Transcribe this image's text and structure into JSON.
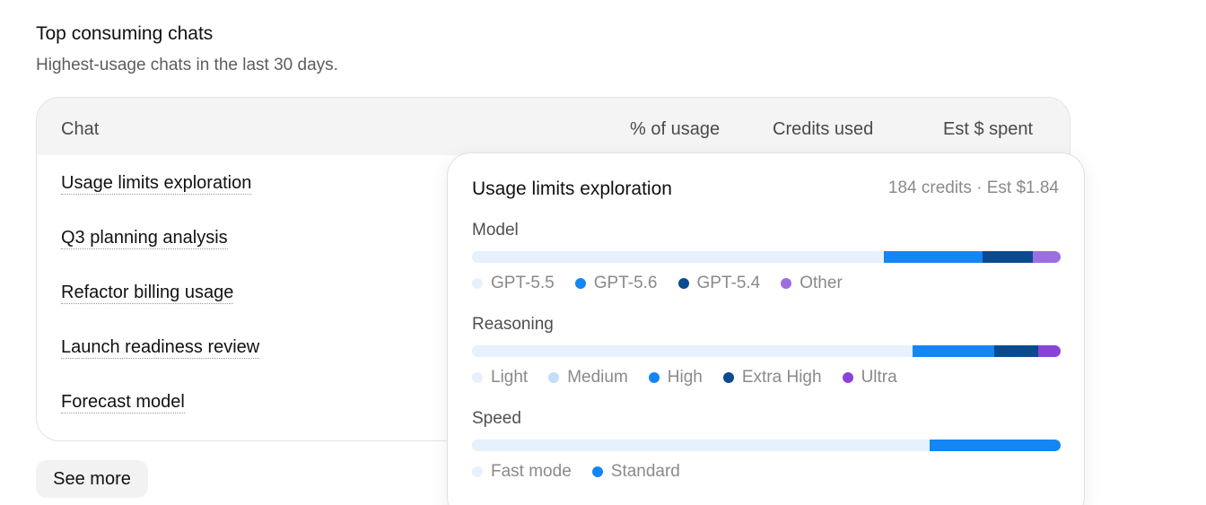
{
  "section": {
    "title": "Top consuming chats",
    "subtitle": "Highest-usage chats in the last 30 days."
  },
  "table": {
    "columns": [
      "Chat",
      "% of usage",
      "Credits used",
      "Est $ spent"
    ],
    "rows": [
      "Usage limits exploration",
      "Q3 planning analysis",
      "Refactor billing usage",
      "Launch readiness review",
      "Forecast model"
    ]
  },
  "see_more_label": "See more",
  "popover": {
    "title": "Usage limits exploration",
    "meta": "184 credits · Est $1.84",
    "groups": [
      {
        "label": "Model",
        "segments": [
          {
            "name": "GPT-5.5",
            "color": "#e6f1fd",
            "fraction": 0.7
          },
          {
            "name": "GPT-5.6",
            "color": "#1485f5",
            "fraction": 0.168
          },
          {
            "name": "GPT-5.4",
            "color": "#0b4a8c",
            "fraction": 0.085
          },
          {
            "name": "Other",
            "color": "#9b6fe0",
            "fraction": 0.047
          }
        ]
      },
      {
        "label": "Reasoning",
        "segments": [
          {
            "name": "Light",
            "color": "#e6f1fd",
            "fraction": 0.0
          },
          {
            "name": "Medium",
            "color": "#e6f1fd",
            "fraction": 0.748
          },
          {
            "name": "High",
            "color": "#1485f5",
            "fraction": 0.139
          },
          {
            "name": "Extra High",
            "color": "#0b4a8c",
            "fraction": 0.075
          },
          {
            "name": "Ultra",
            "color": "#8a43d8",
            "fraction": 0.038
          }
        ]
      },
      {
        "label": "Speed",
        "segments": [
          {
            "name": "Fast mode",
            "color": "#e6f1fd",
            "fraction": 0.777
          },
          {
            "name": "Standard",
            "color": "#1485f5",
            "fraction": 0.223
          }
        ]
      }
    ],
    "legend_colors": {
      "Model": [
        "#e6f1fd",
        "#1485f5",
        "#0b4a8c",
        "#9b6fe0"
      ],
      "Reasoning": [
        "#e6f1fd",
        "#c4ddf8",
        "#1485f5",
        "#0b4a8c",
        "#8a43d8"
      ],
      "Speed": [
        "#e6f1fd",
        "#1485f5"
      ]
    }
  }
}
